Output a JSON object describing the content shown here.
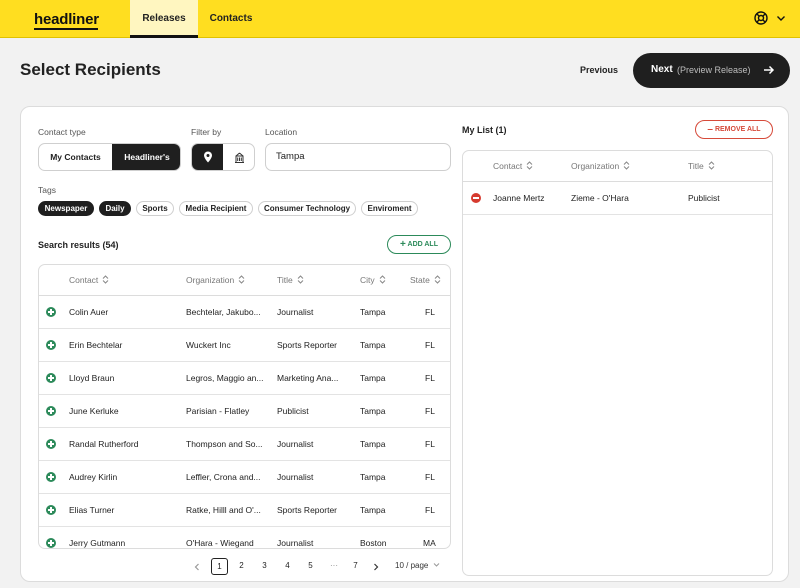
{
  "nav": {
    "logo": "headliner",
    "tabs": [
      {
        "label": "Releases",
        "active": true
      },
      {
        "label": "Contacts",
        "active": false
      }
    ],
    "user_icon": "lifebuoy-icon",
    "menu_icon": "chevron-down-icon"
  },
  "header": {
    "title": "Select Recipients",
    "previous_label": "Previous",
    "next_label": "Next",
    "next_sub": "(Preview Release)",
    "next_icon": "arrow-right-icon"
  },
  "filters": {
    "contact_type_label": "Contact type",
    "contact_type_options": [
      {
        "label": "My Contacts",
        "active": false
      },
      {
        "label": "Headliner's",
        "active": true
      }
    ],
    "filter_by_label": "Filter by",
    "filter_by_options": [
      {
        "icon": "location-pin-icon",
        "active": true
      },
      {
        "icon": "building-icon",
        "active": false
      }
    ],
    "location_label": "Location",
    "location_value": "Tampa",
    "tags_label": "Tags",
    "tags": [
      {
        "label": "Newspaper",
        "active": true
      },
      {
        "label": "Daily",
        "active": true
      },
      {
        "label": "Sports",
        "active": false
      },
      {
        "label": "Media Recipient",
        "active": false
      },
      {
        "label": "Consumer Technology",
        "active": false
      },
      {
        "label": "Enviroment",
        "active": false
      }
    ]
  },
  "results": {
    "title": "Search results (54)",
    "add_all_label": "ADD ALL",
    "columns": [
      "Contact",
      "Organization",
      "Title",
      "City",
      "State"
    ],
    "rows": [
      {
        "contact": "Colin Auer",
        "organization": "Bechtelar, Jakubo...",
        "title": "Journalist",
        "city": "Tampa",
        "state": "FL"
      },
      {
        "contact": "Erin Bechtelar",
        "organization": "Wuckert Inc",
        "title": "Sports Reporter",
        "city": "Tampa",
        "state": "FL"
      },
      {
        "contact": "Lloyd Braun",
        "organization": "Legros, Maggio an...",
        "title": "Marketing Ana...",
        "city": "Tampa",
        "state": "FL"
      },
      {
        "contact": "June Kerluke",
        "organization": "Parisian - Flatley",
        "title": "Publicist",
        "city": "Tampa",
        "state": "FL"
      },
      {
        "contact": "Randal Rutherford",
        "organization": "Thompson and So...",
        "title": "Journalist",
        "city": "Tampa",
        "state": "FL"
      },
      {
        "contact": "Audrey Kirlin",
        "organization": "Leffler, Crona and...",
        "title": "Journalist",
        "city": "Tampa",
        "state": "FL"
      },
      {
        "contact": "Elias Turner",
        "organization": "Ratke, Hilll and O'...",
        "title": "Sports Reporter",
        "city": "Tampa",
        "state": "FL"
      },
      {
        "contact": "Jerry Gutmann",
        "organization": "O'Hara - Wiegand",
        "title": "Journalist",
        "city": "Boston",
        "state": "MA"
      }
    ]
  },
  "pagination": {
    "pages": [
      "1",
      "2",
      "3",
      "4",
      "5",
      "···",
      "7"
    ],
    "current": "1",
    "per_page": "10 / page"
  },
  "my_list": {
    "title": "My List (1)",
    "remove_all_label": "REMOVE ALL",
    "columns": [
      "Contact",
      "Organization",
      "Title"
    ],
    "rows": [
      {
        "contact": "Joanne Mertz",
        "organization": "Zieme - O'Hara",
        "title": "Publicist"
      }
    ]
  },
  "colors": {
    "brand": "#ffde20",
    "dark": "#1f1f1f",
    "add": "#2c8a5a",
    "remove": "#d63a2f"
  }
}
